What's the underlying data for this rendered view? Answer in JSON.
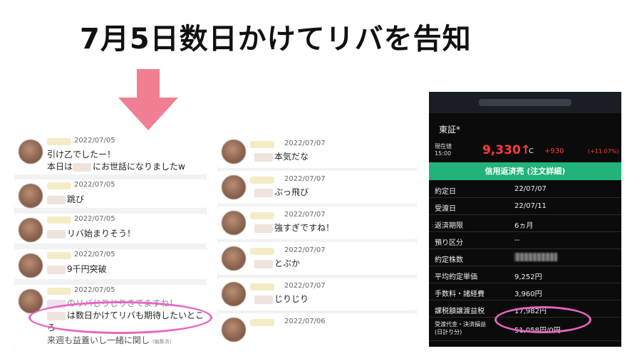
{
  "headline": "7月5日数日かけてリバを告知",
  "colors": {
    "highlight": "#e864c4",
    "arrow": "#f07f94",
    "price_up": "#ff3b3b",
    "band": "#21b37a"
  },
  "left_messages": [
    {
      "date": "2022/07/05",
      "lines": [
        "引け乙でしたー！",
        "本日は{blur}にお世話になりましたw"
      ]
    },
    {
      "date": "2022/07/05",
      "lines": [
        "{blur}跳び"
      ]
    },
    {
      "date": "2022/07/05",
      "lines": [
        "{blur}リバ始まりそう！"
      ]
    },
    {
      "date": "2022/07/05",
      "lines": [
        "{blur}9千円突破"
      ]
    },
    {
      "date": "2022/07/05",
      "lines": [
        "{blur}のリバじりじりきてますね！",
        "{blur}は数日かけてリバも期待したいとこ",
        "ろ",
        "来週も益蓋いし一緒に関し"
      ]
    }
  ],
  "left_texts": {
    "m1_l1": "引け乙でしたー！",
    "m1_l2_a": "本日は",
    "m1_l2_b": "にお世話になりましたw",
    "m2_l1": "跳び",
    "m3_l1": "リバ始まりそう！",
    "m4_l1": "9千円突破",
    "m5_l1": "のリバじりじりきてますね！",
    "m5_l2": "は数日かけてリバも期待したいとこ",
    "m5_l3": "ろ",
    "m5_l4": "来週も益蓋いし一緒に関し",
    "m5_edited": "(編集済)"
  },
  "dates": {
    "l1": "2022/07/05",
    "l2": "2022/07/05",
    "l3": "2022/07/05",
    "l4": "2022/07/05",
    "l5": "2022/07/05",
    "m1": "2022/07/07",
    "m2": "2022/07/07",
    "m3": "2022/07/07",
    "m4": "2022/07/07",
    "m5": "2022/07/07",
    "m6": "2022/07/06"
  },
  "mid_texts": {
    "m1": "本気だな",
    "m2": "ぶっ飛び",
    "m3": "強すぎですね！",
    "m4": "とぶか",
    "m5": "じりじり"
  },
  "stock": {
    "exchange": "東証*",
    "current_label": "現在値",
    "time": "15:00",
    "price": "9,330",
    "price_arrow": "↑",
    "c_mark": "C",
    "change": "+930",
    "change_pct": "(+11.07%)",
    "band_title": "信用返済売 (注文詳細)",
    "rows": [
      {
        "k": "約定日",
        "v": "22/07/07"
      },
      {
        "k": "受渡日",
        "v": "22/07/11"
      },
      {
        "k": "返済期限",
        "v": "6ヵ月"
      },
      {
        "k": "預り区分",
        "v": "--"
      },
      {
        "k": "約定株数",
        "v": ""
      },
      {
        "k": "平均約定単価",
        "v": "9,252円"
      },
      {
        "k": "手数料・諸経費",
        "v": "3,960円"
      },
      {
        "k": "課税額譲渡益税",
        "v": "17,982円"
      }
    ],
    "settle_label_1": "受渡代金・決済損益",
    "settle_label_2": "(日計り分)",
    "settle_value": "51,058円/0円"
  }
}
